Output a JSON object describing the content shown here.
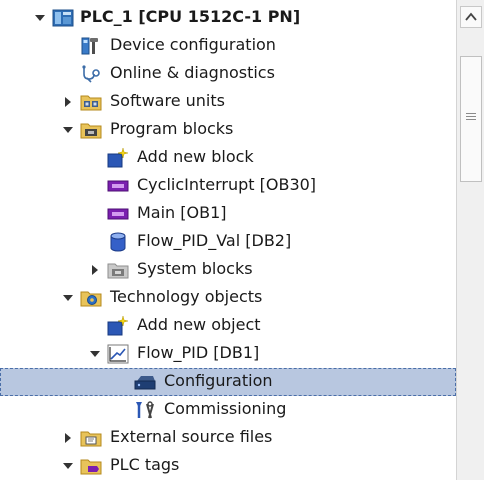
{
  "tree": {
    "items": [
      {
        "label": "PLC_1 [CPU 1512C-1 PN]",
        "expanded": true,
        "icon": "plc-icon"
      },
      {
        "label": "Device configuration",
        "icon": "device-config-icon"
      },
      {
        "label": "Online & diagnostics",
        "icon": "online-diagnostics-icon"
      },
      {
        "label": "Software units",
        "expanded": false,
        "icon": "software-units-folder-icon"
      },
      {
        "label": "Program blocks",
        "expanded": true,
        "icon": "program-blocks-folder-icon"
      },
      {
        "label": "Add new block",
        "icon": "add-new-block-icon"
      },
      {
        "label": "CyclicInterrupt [OB30]",
        "icon": "organization-block-icon"
      },
      {
        "label": "Main [OB1]",
        "icon": "organization-block-icon"
      },
      {
        "label": "Flow_PID_Val [DB2]",
        "icon": "data-block-icon"
      },
      {
        "label": "System blocks",
        "expanded": false,
        "icon": "system-blocks-folder-icon"
      },
      {
        "label": "Technology objects",
        "expanded": true,
        "icon": "technology-objects-folder-icon"
      },
      {
        "label": "Add new object",
        "icon": "add-new-object-icon"
      },
      {
        "label": "Flow_PID [DB1]",
        "expanded": true,
        "icon": "pid-object-icon"
      },
      {
        "label": "Configuration",
        "selected": true,
        "icon": "configuration-icon"
      },
      {
        "label": "Commissioning",
        "icon": "commissioning-icon"
      },
      {
        "label": "External source files",
        "expanded": false,
        "icon": "external-source-files-folder-icon"
      },
      {
        "label": "PLC tags",
        "expanded": true,
        "icon": "plc-tags-folder-icon"
      }
    ]
  },
  "colors": {
    "selection_background": "#b8c7e0",
    "selection_border": "#4a6ea8",
    "text": "#1a1a1a"
  }
}
